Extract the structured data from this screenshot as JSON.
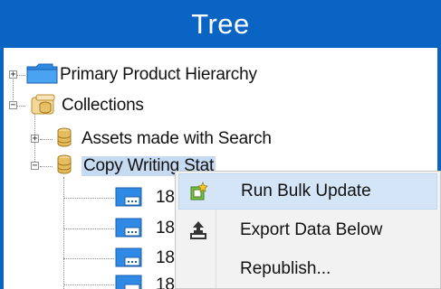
{
  "window": {
    "title": "Tree"
  },
  "tree": {
    "items": [
      {
        "label": "Primary Product Hierarchy",
        "icon": "folder-icon",
        "expander": "+"
      },
      {
        "label": "Collections",
        "icon": "collections-icon",
        "expander": "−"
      },
      {
        "label": "Assets made with Search",
        "icon": "database-icon",
        "expander": "+"
      },
      {
        "label": "Copy Writing Stat",
        "icon": "database-icon",
        "expander": "−"
      },
      {
        "label": "18",
        "icon": "asset-icon"
      },
      {
        "label": "18",
        "icon": "asset-icon"
      },
      {
        "label": "18",
        "icon": "asset-icon"
      },
      {
        "label": "18",
        "icon": "asset-icon"
      }
    ]
  },
  "context_menu": {
    "items": [
      {
        "label": "Run Bulk Update",
        "icon": "bulk-update-icon"
      },
      {
        "label": "Export Data Below",
        "icon": "export-icon"
      },
      {
        "label": "Republish...",
        "icon": ""
      }
    ]
  },
  "colors": {
    "titlebar": "#0a64c4",
    "selection": "#c6daf1",
    "menu_highlight": "#d3e5f7"
  }
}
